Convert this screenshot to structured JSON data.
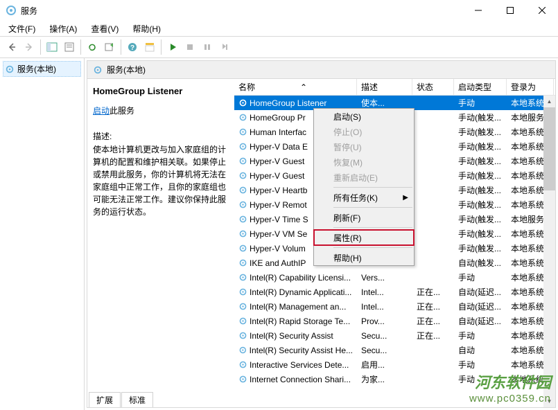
{
  "window": {
    "title": "服务"
  },
  "menubar": [
    "文件(F)",
    "操作(A)",
    "查看(V)",
    "帮助(H)"
  ],
  "leftPane": {
    "label": "服务(本地)"
  },
  "rightHeader": {
    "label": "服务(本地)"
  },
  "infoPanel": {
    "serviceName": "HomeGroup Listener",
    "startLink": "启动",
    "startSuffix": "此服务",
    "descLabel": "描述:",
    "desc": "使本地计算机更改与加入家庭组的计算机的配置和维护相关联。如果停止或禁用此服务，你的计算机将无法在家庭组中正常工作，且你的家庭组也可能无法正常工作。建议你保持此服务的运行状态。"
  },
  "columns": {
    "name": "名称",
    "desc": "描述",
    "status": "状态",
    "startup": "启动类型",
    "logon": "登录为"
  },
  "rows": [
    {
      "name": "HomeGroup Listener",
      "desc": "使本...",
      "status": "",
      "startup": "手动",
      "logon": "本地系统",
      "selected": true
    },
    {
      "name": "HomeGroup Pr",
      "desc": "",
      "status": "",
      "startup": "手动(触发...",
      "logon": "本地服务"
    },
    {
      "name": "Human Interfac",
      "desc": "",
      "status": "",
      "startup": "手动(触发...",
      "logon": "本地系统"
    },
    {
      "name": "Hyper-V Data E",
      "desc": "",
      "status": "",
      "startup": "手动(触发...",
      "logon": "本地系统"
    },
    {
      "name": "Hyper-V Guest",
      "desc": "",
      "status": "",
      "startup": "手动(触发...",
      "logon": "本地系统"
    },
    {
      "name": "Hyper-V Guest",
      "desc": "",
      "status": "",
      "startup": "手动(触发...",
      "logon": "本地系统"
    },
    {
      "name": "Hyper-V Heartb",
      "desc": "",
      "status": "",
      "startup": "手动(触发...",
      "logon": "本地系统"
    },
    {
      "name": "Hyper-V Remot",
      "desc": "",
      "status": "",
      "startup": "手动(触发...",
      "logon": "本地系统"
    },
    {
      "name": "Hyper-V Time S",
      "desc": "",
      "status": "",
      "startup": "手动(触发...",
      "logon": "本地服务"
    },
    {
      "name": "Hyper-V VM Se",
      "desc": "",
      "status": "",
      "startup": "手动(触发...",
      "logon": "本地系统"
    },
    {
      "name": "Hyper-V Volum",
      "desc": "",
      "status": "",
      "startup": "手动(触发...",
      "logon": "本地系统"
    },
    {
      "name": "IKE and AuthIP",
      "desc": "",
      "status": "",
      "startup": "自动(触发...",
      "logon": "本地系统"
    },
    {
      "name": "Intel(R) Capability Licensi...",
      "desc": "Vers...",
      "status": "",
      "startup": "手动",
      "logon": "本地系统"
    },
    {
      "name": "Intel(R) Dynamic Applicati...",
      "desc": "Intel...",
      "status": "正在...",
      "startup": "自动(延迟...",
      "logon": "本地系统"
    },
    {
      "name": "Intel(R) Management an...",
      "desc": "Intel...",
      "status": "正在...",
      "startup": "自动(延迟...",
      "logon": "本地系统"
    },
    {
      "name": "Intel(R) Rapid Storage Te...",
      "desc": "Prov...",
      "status": "正在...",
      "startup": "自动(延迟...",
      "logon": "本地系统"
    },
    {
      "name": "Intel(R) Security Assist",
      "desc": "Secu...",
      "status": "正在...",
      "startup": "手动",
      "logon": "本地系统"
    },
    {
      "name": "Intel(R) Security Assist He...",
      "desc": "Secu...",
      "status": "",
      "startup": "自动",
      "logon": "本地系统"
    },
    {
      "name": "Interactive Services Dete...",
      "desc": "启用...",
      "status": "",
      "startup": "手动",
      "logon": "本地系统"
    },
    {
      "name": "Internet Connection Shari...",
      "desc": "为家...",
      "status": "",
      "startup": "手动",
      "logon": "本地系统"
    }
  ],
  "contextMenu": [
    {
      "label": "启动(S)",
      "enabled": true
    },
    {
      "label": "停止(O)",
      "enabled": false
    },
    {
      "label": "暂停(U)",
      "enabled": false
    },
    {
      "label": "恢复(M)",
      "enabled": false
    },
    {
      "label": "重新启动(E)",
      "enabled": false
    },
    {
      "sep": true
    },
    {
      "label": "所有任务(K)",
      "enabled": true,
      "submenu": true
    },
    {
      "sep": true
    },
    {
      "label": "刷新(F)",
      "enabled": true
    },
    {
      "sep": true
    },
    {
      "label": "属性(R)",
      "enabled": true,
      "highlighted": true
    },
    {
      "sep": true
    },
    {
      "label": "帮助(H)",
      "enabled": true
    }
  ],
  "tabs": {
    "extended": "扩展",
    "standard": "标准"
  },
  "watermark": {
    "line1": "河东软件园",
    "line2": "www.pc0359.cn"
  }
}
